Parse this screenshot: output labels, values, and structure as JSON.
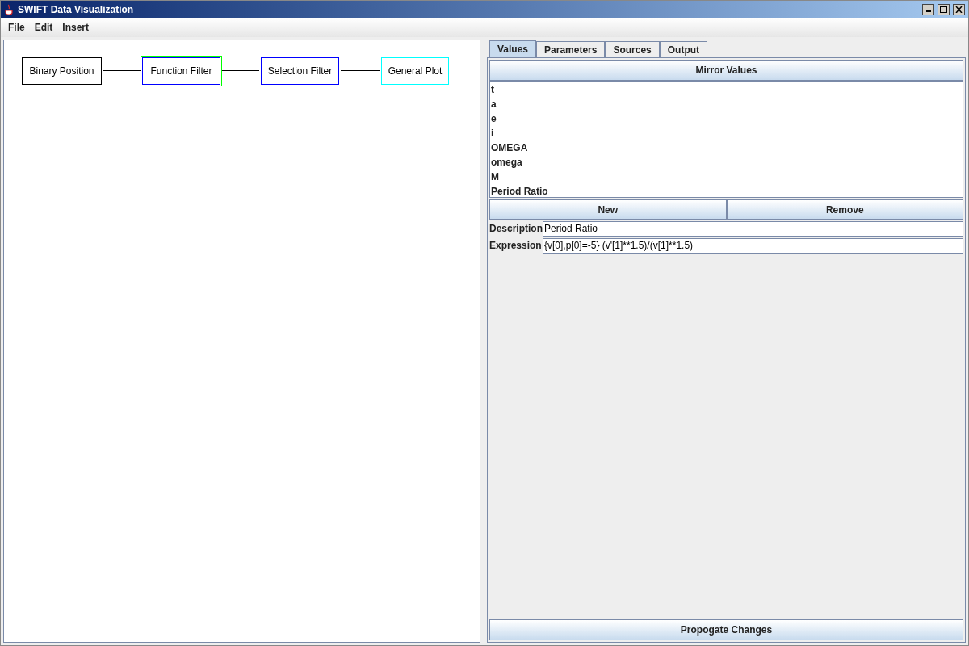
{
  "window": {
    "title": "SWIFT Data Visualization"
  },
  "menu": [
    "File",
    "Edit",
    "Insert"
  ],
  "diagram": {
    "nodes": [
      {
        "label": "Binary Position",
        "color": "#000000",
        "selected": false
      },
      {
        "label": "Function Filter",
        "color": "#0000ff",
        "selected": true
      },
      {
        "label": "Selection Filter",
        "color": "#0000ff",
        "selected": false
      },
      {
        "label": "General Plot",
        "color": "#00ffff",
        "selected": false
      }
    ]
  },
  "tabs": [
    {
      "label": "Values",
      "selected": true
    },
    {
      "label": "Parameters",
      "selected": false
    },
    {
      "label": "Sources",
      "selected": false
    },
    {
      "label": "Output",
      "selected": false
    }
  ],
  "mirror_button": "Mirror Values",
  "values": [
    "t",
    "a",
    "e",
    "i",
    "OMEGA",
    "omega",
    "M",
    "Period Ratio"
  ],
  "list_buttons": [
    "New",
    "Remove"
  ],
  "fields": [
    {
      "label": "Description",
      "value": "Period Ratio"
    },
    {
      "label": "Expression",
      "value": "{v[0],p[0]=-5} (v'[1]**1.5)/(v[1]**1.5)"
    }
  ],
  "propagate_button": "Propogate Changes"
}
